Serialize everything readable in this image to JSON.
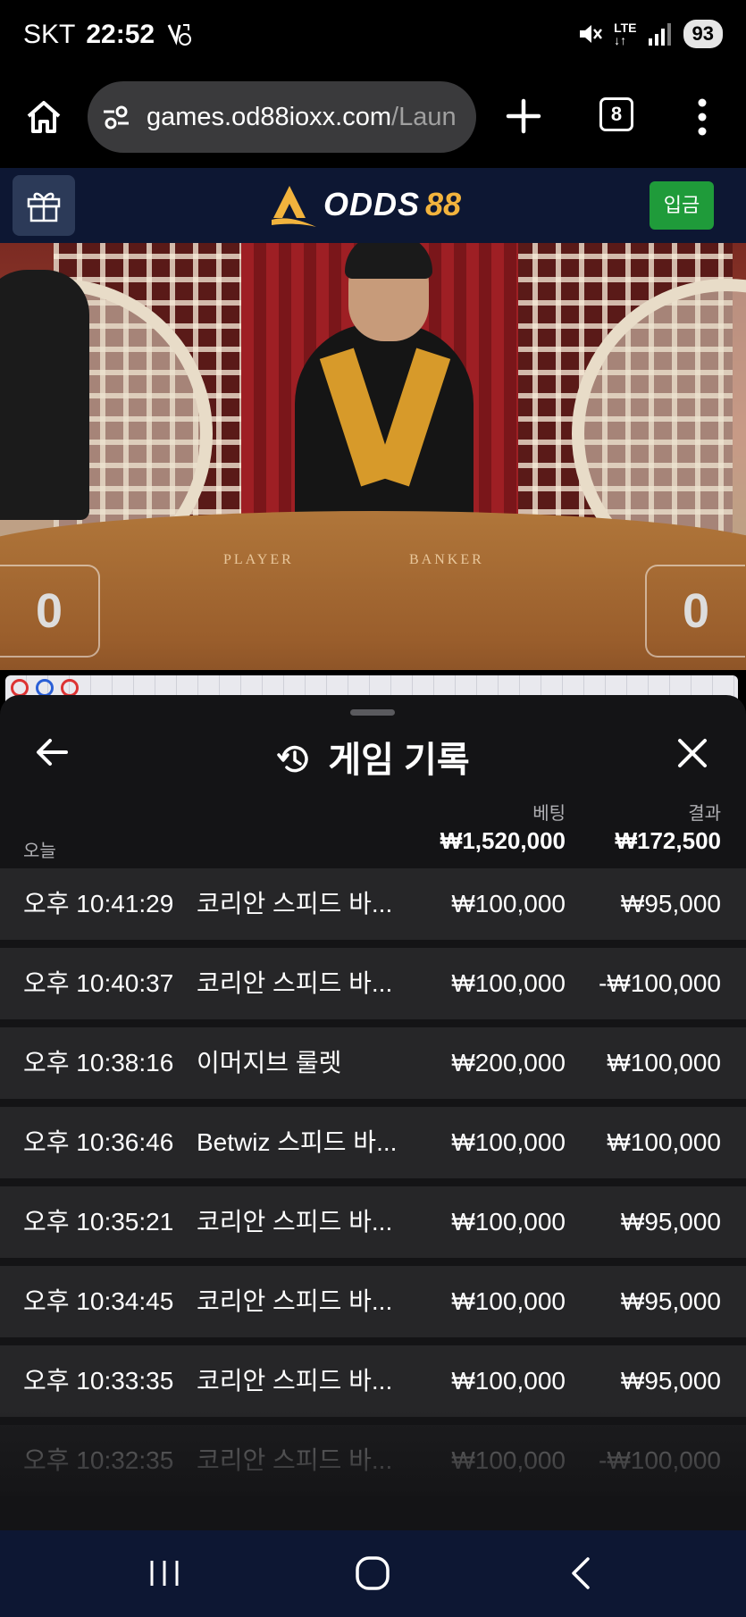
{
  "status_bar": {
    "carrier": "SKT",
    "time": "22:52",
    "network": "LTE",
    "battery": "93"
  },
  "browser": {
    "url_host": "games.od88ioxx.com",
    "url_path": "/Laun",
    "tab_count": "8"
  },
  "site_header": {
    "logo_part1": "ODDS",
    "logo_part2": "88",
    "deposit_label": "입금"
  },
  "video": {
    "player_label": "PLAYER",
    "banker_label": "BANKER",
    "player_score": "0",
    "banker_score": "0"
  },
  "history": {
    "title": "게임 기록",
    "col_bet": "베팅",
    "col_result": "결과",
    "today_label": "오늘",
    "total_bet": "₩1,520,000",
    "total_result": "₩172,500",
    "rows": [
      {
        "time": "오후 10:41:29",
        "game": "코리안 스피드 바...",
        "bet": "₩100,000",
        "result": "₩95,000"
      },
      {
        "time": "오후 10:40:37",
        "game": "코리안 스피드 바...",
        "bet": "₩100,000",
        "result": "-₩100,000"
      },
      {
        "time": "오후 10:38:16",
        "game": "이머지브 룰렛",
        "bet": "₩200,000",
        "result": "₩100,000"
      },
      {
        "time": "오후 10:36:46",
        "game": "Betwiz 스피드 바...",
        "bet": "₩100,000",
        "result": "₩100,000"
      },
      {
        "time": "오후 10:35:21",
        "game": "코리안 스피드 바...",
        "bet": "₩100,000",
        "result": "₩95,000"
      },
      {
        "time": "오후 10:34:45",
        "game": "코리안 스피드 바...",
        "bet": "₩100,000",
        "result": "₩95,000"
      },
      {
        "time": "오후 10:33:35",
        "game": "코리안 스피드 바...",
        "bet": "₩100,000",
        "result": "₩95,000"
      },
      {
        "time": "오후 10:32:35",
        "game": "코리안 스피드 바...",
        "bet": "₩100,000",
        "result": "-₩100,000"
      }
    ]
  },
  "colors": {
    "header_bg": "#0d1733",
    "deposit_green": "#1f9b3a",
    "logo_gold": "#f2b33d",
    "sheet_bg": "#141416",
    "row_bg": "#262628"
  },
  "icons": [
    "home-icon",
    "tune-icon",
    "plus-icon",
    "tabs-icon",
    "more-vert-icon",
    "gift-icon",
    "history-icon",
    "arrow-back-icon",
    "close-icon",
    "recents-icon",
    "home-circle-icon",
    "nav-back-icon",
    "mute-icon",
    "signal-icon",
    "wifi-calling-icon"
  ]
}
